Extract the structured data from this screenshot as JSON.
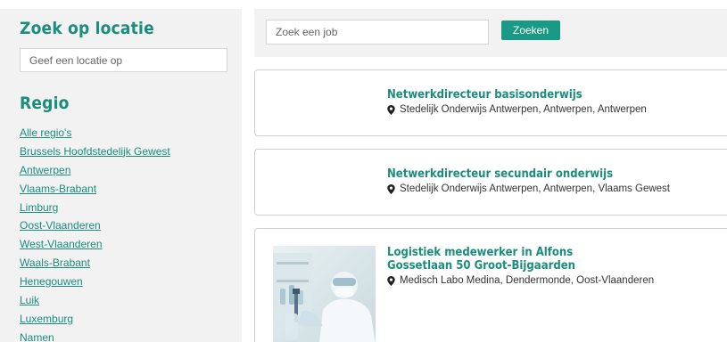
{
  "sidebar": {
    "location_heading": "Zoek op locatie",
    "location_placeholder": "Geef een locatie op",
    "region_heading": "Regio",
    "regions": [
      "Alle regio's",
      "Brussels Hoofdstedelijk Gewest",
      "Antwerpen",
      "Vlaams-Brabant",
      "Limburg",
      "Oost-Vlaanderen",
      "West-Vlaanderen",
      "Waals-Brabant",
      "Henegouwen",
      "Luik",
      "Luxemburg",
      "Namen"
    ]
  },
  "search": {
    "job_placeholder": "Zoek een job",
    "button_label": "Zoeken"
  },
  "jobs": [
    {
      "title": "Netwerkdirecteur basisonderwijs",
      "location": "Stedelijk Onderwijs Antwerpen, Antwerpen, Antwerpen",
      "icon": "map-pin-icon"
    },
    {
      "title": "Netwerkdirecteur secundair onderwijs",
      "location": "Stedelijk Onderwijs Antwerpen, Antwerpen, Vlaams Gewest",
      "icon": "map-pin-icon"
    },
    {
      "title": "Logistiek medewerker in Alfons Gossetlaan 50 Groot-Bijgaarden",
      "location": "Medisch Labo Medina, Dendermonde, Oost-Vlaanderen",
      "icon": "map-pin-icon"
    }
  ],
  "colors": {
    "accent": "#1a8d7b",
    "button": "#1a9a85",
    "panel_bg": "#f2f2f2",
    "card_border": "#cfcfcf"
  }
}
